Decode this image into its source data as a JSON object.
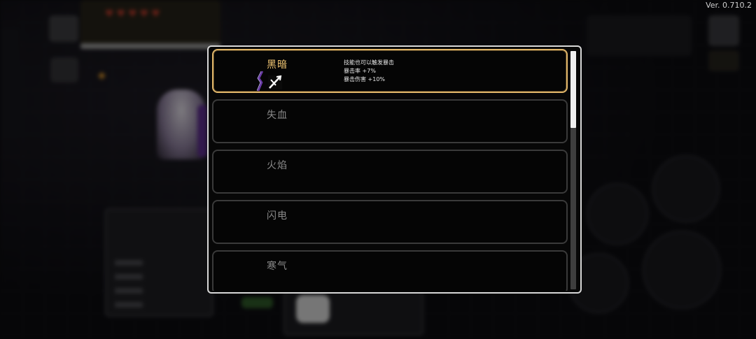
{
  "version": "Ver. 0.710.2",
  "colors": {
    "selected_border": "#e1b66a",
    "selected_name": "#f2c773",
    "unselected_name": "#8a8a8a",
    "dark_icon_accent": "#5a2c8a"
  },
  "effects_list": {
    "scroll_position": 0,
    "items": [
      {
        "name": "黑暗",
        "selected": true,
        "icon": "dark-arrow-icon",
        "description": [
          "技能也可以触发暴击",
          "暴击率 +7%",
          "暴击伤害 +10%"
        ]
      },
      {
        "name": "失血",
        "selected": false
      },
      {
        "name": "火焰",
        "selected": false
      },
      {
        "name": "闪电",
        "selected": false
      },
      {
        "name": "寒气",
        "selected": false
      }
    ]
  }
}
